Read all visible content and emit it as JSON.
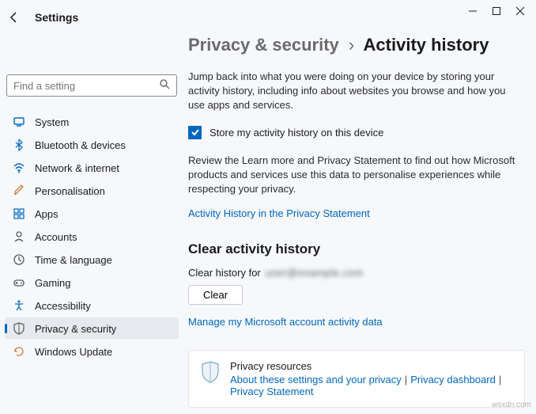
{
  "window": {
    "title": "Settings"
  },
  "search": {
    "placeholder": "Find a setting"
  },
  "sidebar": {
    "items": [
      {
        "label": "System"
      },
      {
        "label": "Bluetooth & devices"
      },
      {
        "label": "Network & internet"
      },
      {
        "label": "Personalisation"
      },
      {
        "label": "Apps"
      },
      {
        "label": "Accounts"
      },
      {
        "label": "Time & language"
      },
      {
        "label": "Gaming"
      },
      {
        "label": "Accessibility"
      },
      {
        "label": "Privacy & security"
      },
      {
        "label": "Windows Update"
      }
    ]
  },
  "breadcrumb": {
    "parent": "Privacy & security",
    "current": "Activity history"
  },
  "intro": "Jump back into what you were doing on your device by storing your activity history, including info about websites you browse and how you use apps and services.",
  "checkbox": {
    "checked": true,
    "label": "Store my activity history on this device"
  },
  "review": "Review the Learn more and Privacy Statement to find out how Microsoft products and services use this data to personalise experiences while respecting your privacy.",
  "privacy_link": "Activity History in the Privacy Statement",
  "clear_section": {
    "heading": "Clear activity history",
    "for_label": "Clear history for",
    "account": "user@example.com",
    "button": "Clear"
  },
  "manage_link": "Manage my Microsoft account activity data",
  "resources": {
    "title": "Privacy resources",
    "links": [
      "About these settings and your privacy",
      "Privacy dashboard",
      "Privacy Statement"
    ]
  },
  "watermark": "wsxdn.com"
}
